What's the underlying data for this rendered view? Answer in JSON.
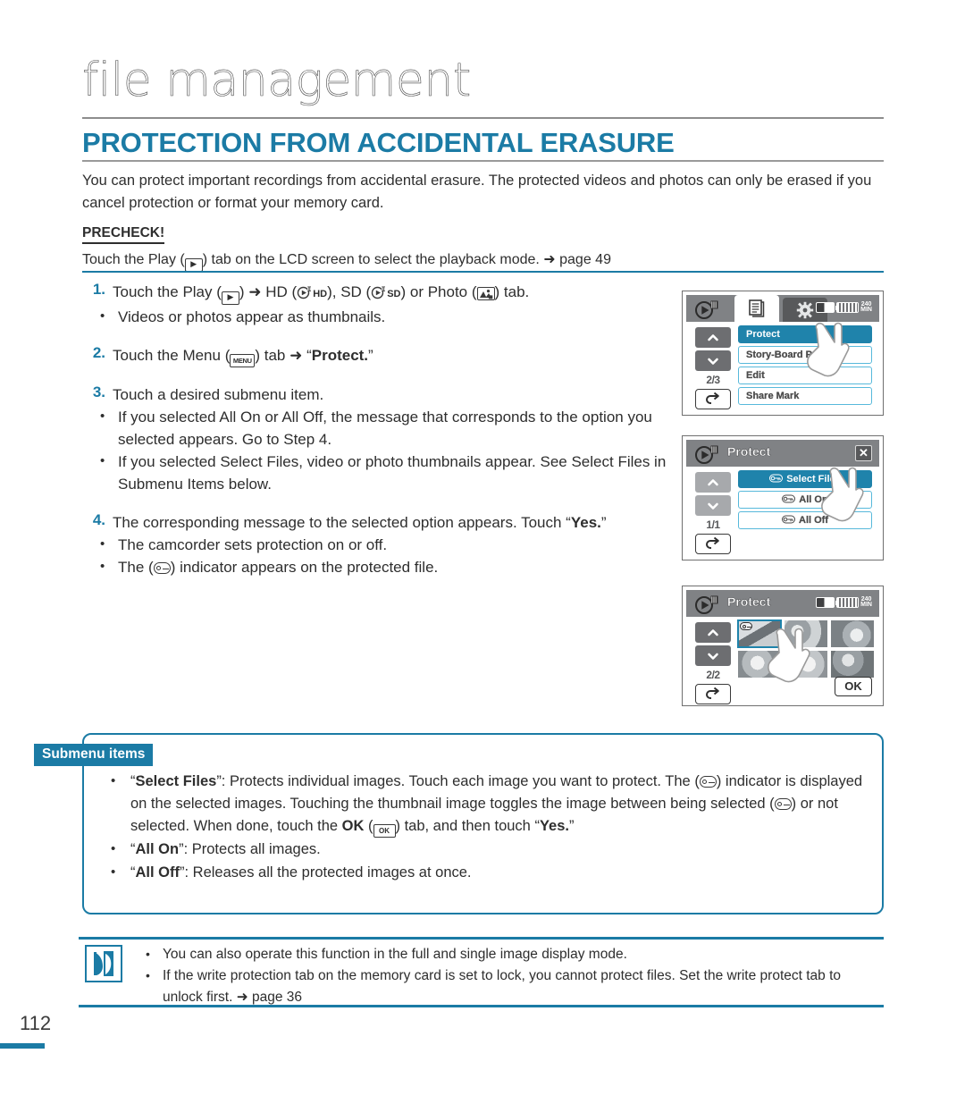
{
  "header": {
    "chapter_title": "file management",
    "section_title": "PROTECTION FROM ACCIDENTAL ERASURE",
    "intro": "You can protect important recordings from accidental erasure. The protected videos and photos can only be erased if you cancel protection or format your memory card.",
    "precheck_label": "PRECHECK!",
    "precheck_pre": "Touch the Play (",
    "precheck_post": ") tab on the LCD screen to select the playback mode. ➜ page 49"
  },
  "steps": [
    {
      "num": "1.",
      "text_parts": [
        "Touch the Play (",
        ") ➜ HD (",
        "), SD (",
        ") or Photo (",
        ") tab."
      ],
      "bullets": [
        "Videos or photos appear as thumbnails."
      ]
    },
    {
      "num": "2.",
      "text_parts": [
        "Touch the Menu (",
        ") tab ➜ “",
        "”"
      ],
      "bold": "Protect.",
      "bullets": []
    },
    {
      "num": "3.",
      "text": "Touch a desired submenu item.",
      "bullets": [
        "If you selected All On or All Off, the message that corresponds to the option you selected appears. Go to Step 4.",
        "If you selected Select Files, video or photo thumbnails appear. See Select Files in Submenu Items below."
      ]
    },
    {
      "num": "4.",
      "text": "The corresponding message to the selected option appears. Touch “Yes.”",
      "bullets": [
        "The camcorder sets protection on or off.",
        "The ( ) indicator appears on the protected file."
      ]
    }
  ],
  "step4_touch_pre": "The corresponding message to the selected option appears. Touch “",
  "step4_touch_bold": "Yes.",
  "step4_touch_post": "”",
  "step4_bullet2_pre": "The (",
  "step4_bullet2_post": ") indicator appears on the protected file.",
  "screens": [
    {
      "name": "menu-screen",
      "tabs": [
        "play-icon",
        "menu-list-icon",
        "settings-gear-icon"
      ],
      "battery_minutes": "240",
      "battery_unit": "MIN",
      "page_indicator": "2/3",
      "items": [
        {
          "label": "Protect",
          "selected": true
        },
        {
          "label": "Story-Board Print",
          "selected": false
        },
        {
          "label": "Edit",
          "selected": false
        },
        {
          "label": "Share Mark",
          "selected": false
        }
      ]
    },
    {
      "name": "protect-submenu-screen",
      "title": "Protect",
      "close_label": "✕",
      "page_indicator": "1/1",
      "items": [
        {
          "label": "Select Files",
          "selected": true
        },
        {
          "label": "All On",
          "selected": false
        },
        {
          "label": "All Off",
          "selected": false
        }
      ]
    },
    {
      "name": "protect-thumbnail-screen",
      "title": "Protect",
      "battery_minutes": "240",
      "battery_unit": "MIN",
      "page_indicator": "2/2",
      "ok_label": "OK",
      "thumbnails": [
        {
          "selected": true,
          "protected": true
        },
        {
          "selected": false,
          "protected": false
        },
        {
          "selected": false,
          "protected": false
        },
        {
          "selected": false,
          "protected": false
        },
        {
          "selected": false,
          "protected": false
        },
        {
          "selected": false,
          "protected": false
        }
      ]
    }
  ],
  "submenu": {
    "badge": "Submenu items",
    "item1_a": "“",
    "item1_b": "Select Files",
    "item1_c": "”: Protects individual images. Touch each image you want to protect. The (",
    "item1_d": ") indicator is displayed on the selected images. Touching the thumbnail image toggles the image between being selected (",
    "item1_e": ") or not selected. When done, touch the ",
    "item1_ok": "OK",
    "item1_f": " (",
    "item1_g": ") tab, and then touch “",
    "item1_yes": "Yes.",
    "item1_h": "”",
    "item2_a": "“",
    "item2_b": "All On",
    "item2_c": "”: Protects all images.",
    "item3_a": "“",
    "item3_b": "All Off",
    "item3_c": "”: Releases all the protected images at once."
  },
  "notes": {
    "note1": "You can also operate this function in the full and single image display mode.",
    "note2": "If the write protection tab on the memory card is set to lock, you cannot protect files. Set the write protect tab to unlock first. ➜ page 36"
  },
  "page_number": "112",
  "colors": {
    "accent": "#1b7ba5",
    "menu_selected": "#1f83ab",
    "menu_border": "#57b9db",
    "lcd_bar": "#808285"
  }
}
